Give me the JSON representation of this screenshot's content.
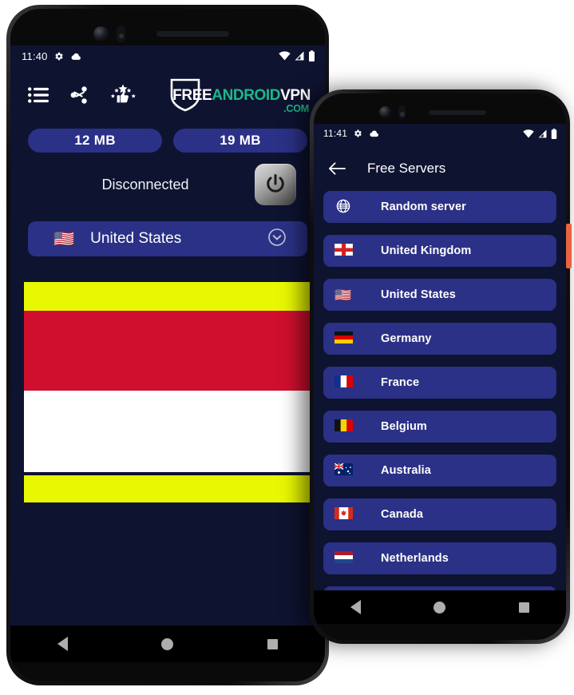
{
  "app": {
    "brand": {
      "logo_part1": "FREE",
      "logo_part2": "ANDROID",
      "logo_part3": "VPN",
      "logo_suffix": ".COM",
      "color_white": "#ffffff",
      "color_teal": "#19b98a"
    },
    "colors": {
      "screen_background": "#0e1330",
      "accent_blue": "#2b3186",
      "band_yellow": "#e8f803",
      "band_red": "#cf0f2d",
      "band_white": "#ffffff",
      "side_button_orange": "#e8653f"
    }
  },
  "phone_left": {
    "statusbar": {
      "time": "11:40",
      "left_icons": [
        "gear-icon",
        "cloud-icon"
      ],
      "right_icons": [
        "wifi-icon",
        "signal-icon",
        "battery-icon"
      ]
    },
    "toolbar": {
      "icons": [
        {
          "name": "list-menu-icon",
          "label": "Menu"
        },
        {
          "name": "share-icon",
          "label": "Share"
        },
        {
          "name": "rate-thumbs-up-icon",
          "label": "Rate"
        }
      ]
    },
    "stats": {
      "download_label": "12 MB",
      "upload_label": "19 MB"
    },
    "connection": {
      "status_text": "Disconnected",
      "power_button_label": "power-button"
    },
    "server_selector": {
      "flag": "🇺🇸",
      "country": "United States",
      "chevron": "chevron-down-icon"
    },
    "ad_banner": {
      "bands": [
        "yellow",
        "red",
        "white",
        "yellow"
      ]
    },
    "navbar": {
      "back": "back-triangle",
      "home": "home-circle",
      "recents": "recents-square"
    }
  },
  "phone_right": {
    "statusbar": {
      "time": "11:41",
      "left_icons": [
        "gear-icon",
        "cloud-icon"
      ],
      "right_icons": [
        "wifi-icon",
        "signal-icon",
        "battery-icon"
      ]
    },
    "appbar": {
      "back_icon": "arrow-left-icon",
      "title": "Free Servers"
    },
    "servers": [
      {
        "flag": "globe",
        "name": "Random server"
      },
      {
        "flag": "🏴󠁧󠁢󠁥󠁮󠁧󠁿",
        "name": "United Kingdom"
      },
      {
        "flag": "🇺🇸",
        "name": "United States"
      },
      {
        "flag": "🇩🇪",
        "name": "Germany"
      },
      {
        "flag": "🇫🇷",
        "name": "France"
      },
      {
        "flag": "🇧🇪",
        "name": "Belgium"
      },
      {
        "flag": "🇦🇺",
        "name": "Australia"
      },
      {
        "flag": "🇨🇦",
        "name": "Canada"
      },
      {
        "flag": "🇳🇱",
        "name": "Netherlands"
      }
    ],
    "navbar": {
      "back": "back-triangle",
      "home": "home-circle",
      "recents": "recents-square"
    }
  }
}
